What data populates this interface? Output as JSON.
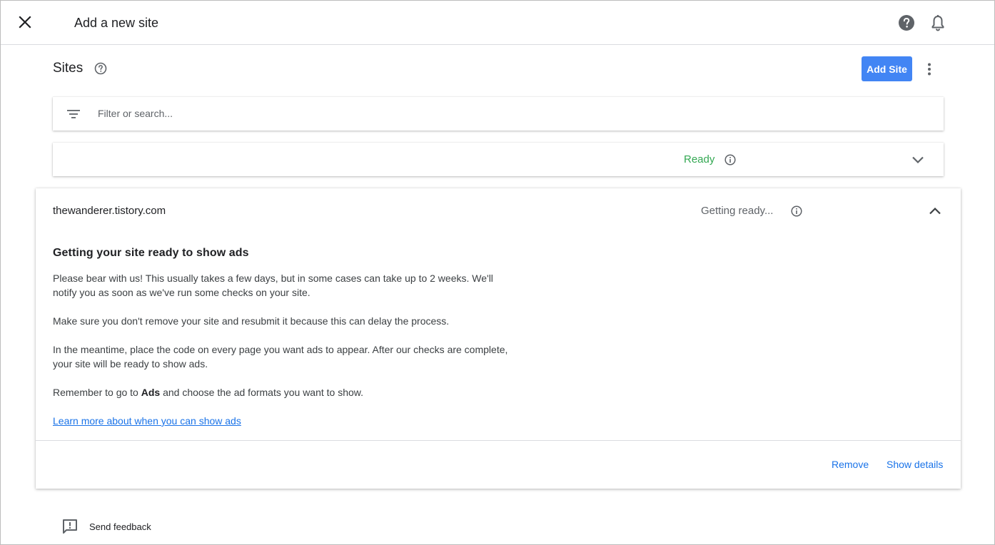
{
  "topbar": {
    "title": "Add a new site",
    "close_icon": "close-icon",
    "help_icon": "help-icon",
    "notifications_icon": "bell-icon"
  },
  "sites": {
    "title": "Sites",
    "help_icon": "help-outline-icon",
    "add_button_label": "Add Site",
    "more_icon": "more-vert-icon"
  },
  "filter": {
    "icon": "filter-list-icon",
    "placeholder": "Filter or search..."
  },
  "ready_group": {
    "status": "Ready",
    "status_color": "#34a853",
    "info_icon": "info-icon",
    "chevron_icon": "chevron-down-icon"
  },
  "site_card": {
    "url": "thewanderer.tistory.com",
    "status": "Getting ready...",
    "info_icon": "info-icon",
    "chevron_icon": "chevron-up-icon",
    "heading": "Getting your site ready to show ads",
    "paragraph_1": "Please bear with us! This usually takes a few days, but in some cases can take up to 2 weeks. We'll notify you as soon as we've run some checks on your site.",
    "paragraph_2": "Make sure you don't remove your site and resubmit it because this can delay the process.",
    "paragraph_3": "In the meantime, place the code on every page you want ads to appear. After our checks are complete, your site will be ready to show ads.",
    "paragraph_4_prefix": "Remember to go to ",
    "paragraph_4_bold": "Ads",
    "paragraph_4_suffix": " and choose the ad formats you want to show.",
    "learn_more_link": "Learn more about when you can show ads",
    "remove_label": "Remove",
    "show_details_label": "Show details"
  },
  "feedback": {
    "icon": "feedback-icon",
    "label": "Send feedback"
  },
  "colors": {
    "accent": "#4285f4",
    "link": "#1a73e8",
    "ready_green": "#34a853"
  }
}
